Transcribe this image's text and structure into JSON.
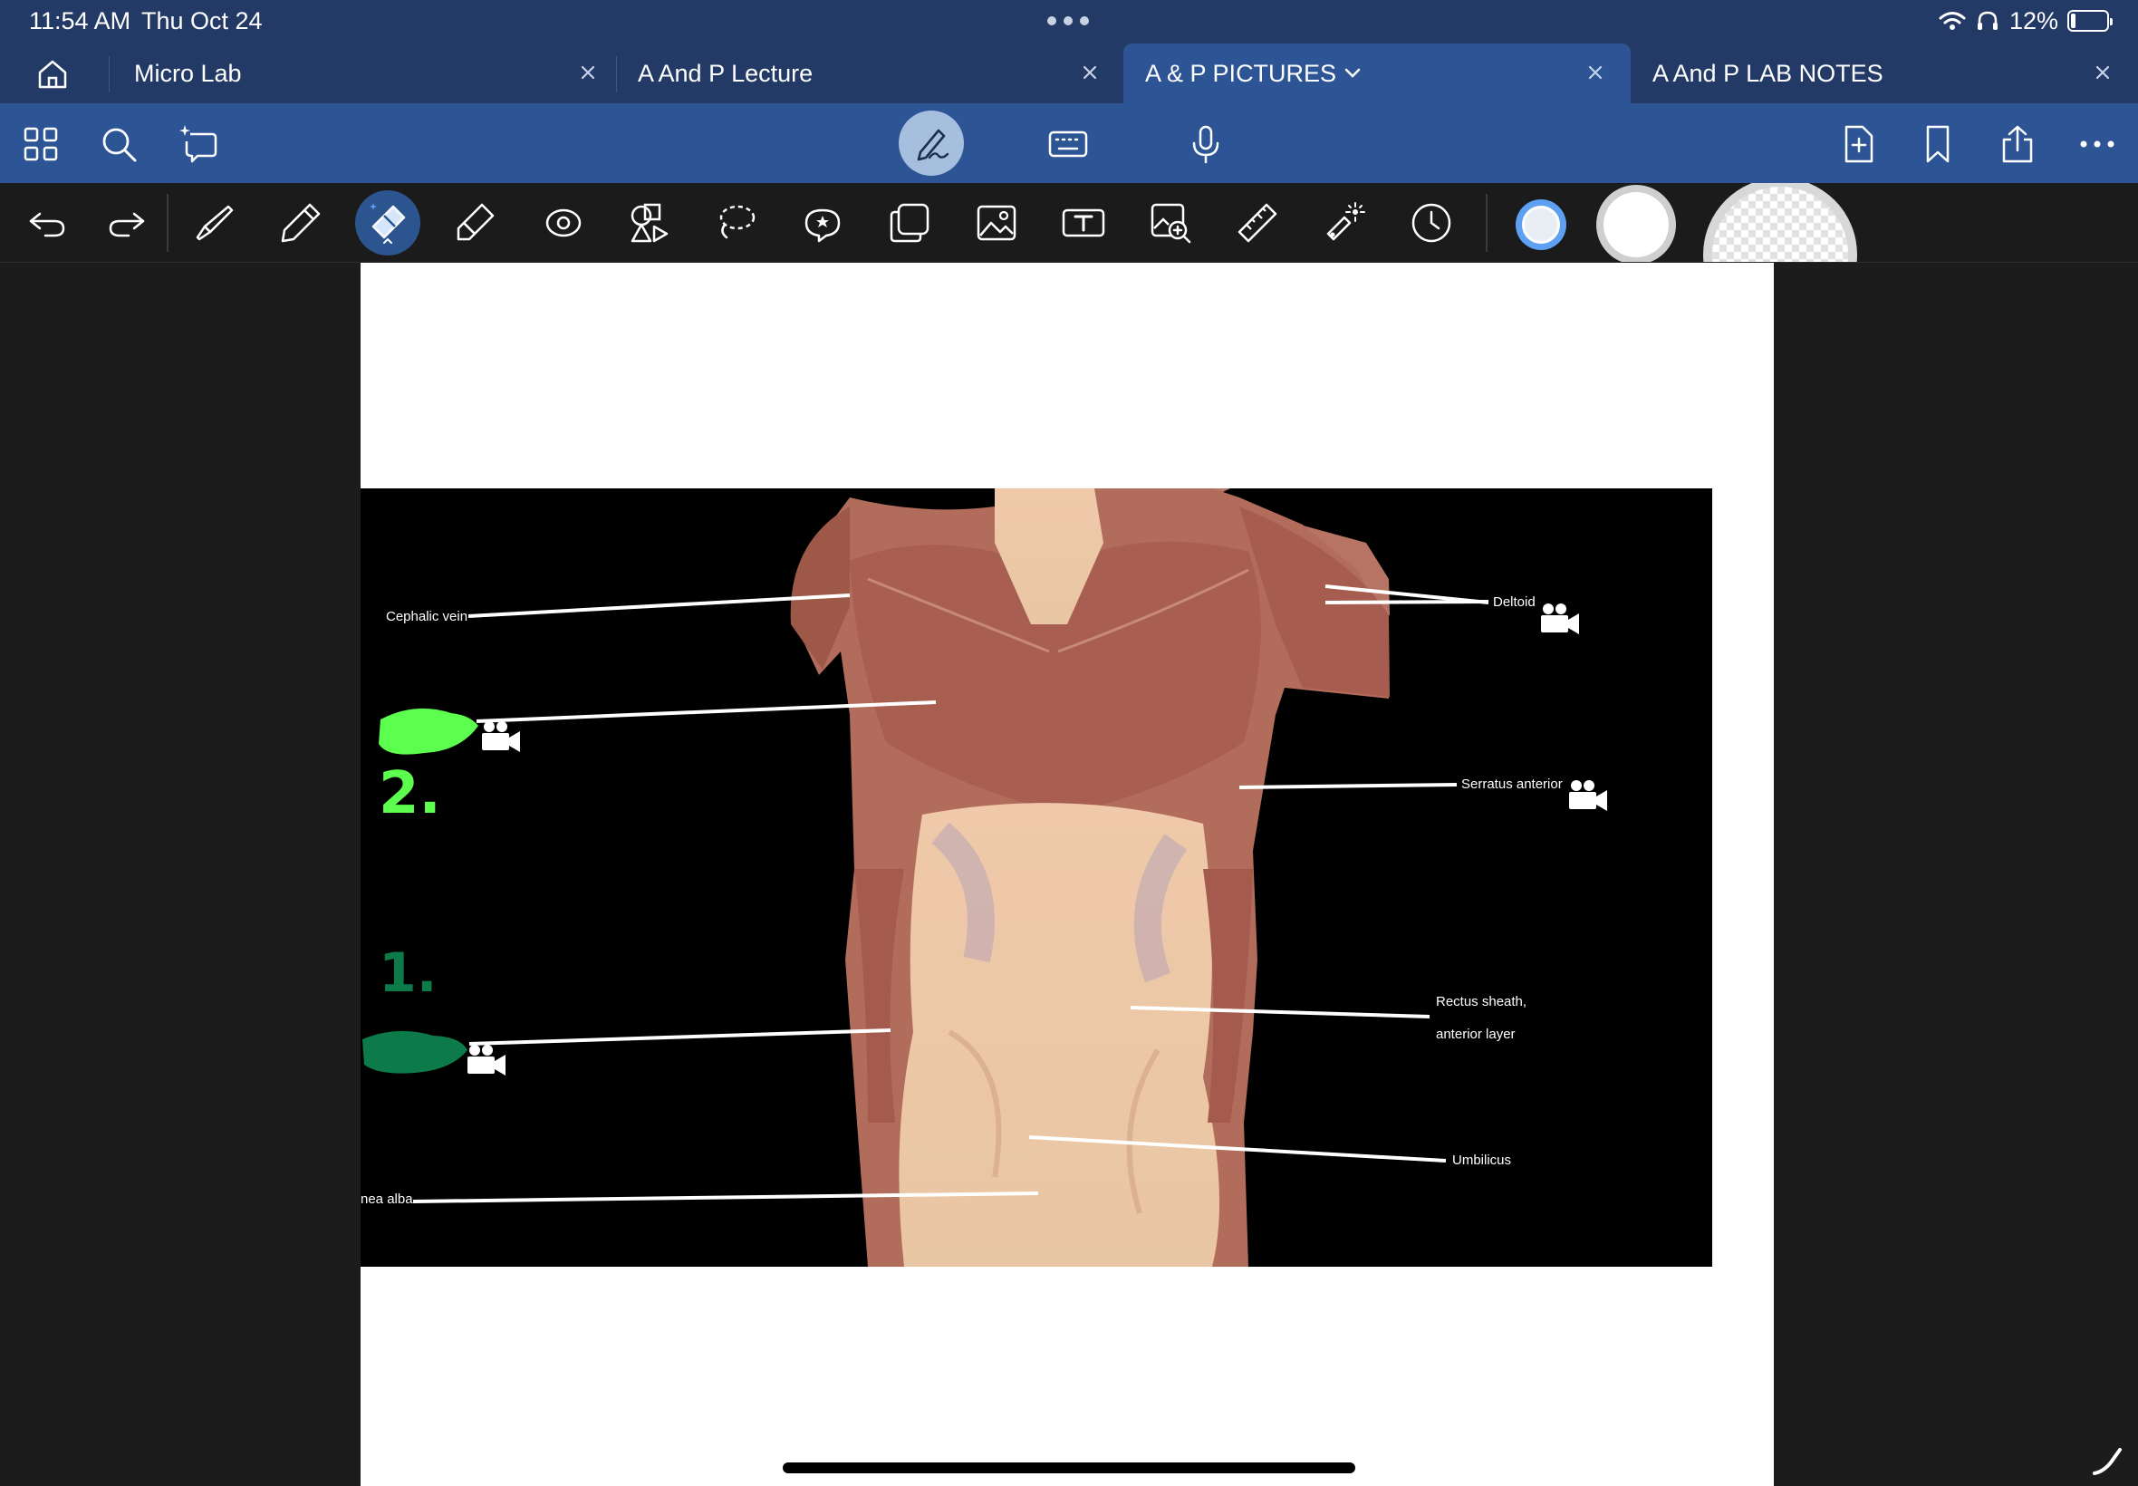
{
  "status": {
    "time": "11:54 AM",
    "date": "Thu Oct 24",
    "battery": "12%",
    "battery_level": 0.12
  },
  "tabs": [
    {
      "label": "Micro Lab"
    },
    {
      "label": "A And P Lecture"
    },
    {
      "label": "A  & P  PICTURES"
    },
    {
      "label": "A And P LAB NOTES"
    }
  ],
  "active_tab": 2,
  "toolbar": {
    "left": [
      "grid-icon",
      "search-icon",
      "sparkle-lasso-icon"
    ],
    "center": [
      "pen-mode-icon",
      "keyboard-icon",
      "microphone-icon"
    ],
    "right": [
      "add-page-icon",
      "bookmark-icon",
      "share-icon",
      "more-icon"
    ]
  },
  "tools": [
    "undo",
    "redo",
    "fountain-pen",
    "pencil",
    "eraser",
    "highlighter",
    "shapes",
    "shape-library",
    "lasso",
    "sticker",
    "sticky-note",
    "image",
    "text",
    "image-search",
    "ruler",
    "laser-pointer",
    "timer"
  ],
  "colors": {
    "status_bg": "#233a67",
    "toolbar_bg": "#2d5596",
    "swatch_selected": "#5ea1f2",
    "highlight_bright_green": "#5dff4f",
    "highlight_dark_green": "#0c7a49"
  },
  "figure": {
    "labels": {
      "cephalic_vein": "Cephalic vein",
      "deltoid": "Deltoid",
      "serratus_anterior": "Serratus anterior",
      "rectus_sheath_line1": "Rectus sheath,",
      "rectus_sheath_line2": "anterior layer",
      "umbilicus": "Umbilicus",
      "linea_alba": "nea alba"
    },
    "handwriting": {
      "number_top": "2.",
      "number_bottom": "1."
    }
  }
}
